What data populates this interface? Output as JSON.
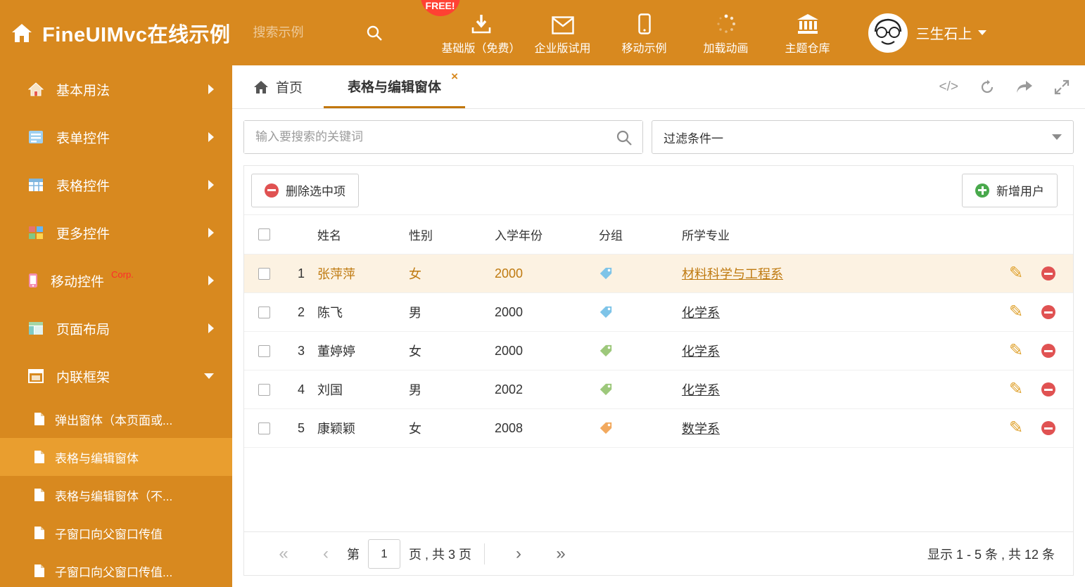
{
  "header": {
    "title": "FineUIMvc在线示例",
    "search_placeholder": "搜索示例",
    "free_badge": "FREE!",
    "nav": [
      {
        "label": "基础版（免费）"
      },
      {
        "label": "企业版试用"
      },
      {
        "label": "移动示例"
      },
      {
        "label": "加载动画"
      },
      {
        "label": "主题仓库"
      }
    ],
    "user_name": "三生石上"
  },
  "sidebar": {
    "items": [
      {
        "label": "基本用法"
      },
      {
        "label": "表单控件"
      },
      {
        "label": "表格控件"
      },
      {
        "label": "更多控件"
      },
      {
        "label": "移动控件",
        "badge": "Corp."
      },
      {
        "label": "页面布局"
      },
      {
        "label": "内联框架"
      }
    ],
    "subitems": [
      {
        "label": "弹出窗体（本页面或..."
      },
      {
        "label": "表格与编辑窗体"
      },
      {
        "label": "表格与编辑窗体（不..."
      },
      {
        "label": "子窗口向父窗口传值"
      },
      {
        "label": "子窗口向父窗口传值..."
      }
    ]
  },
  "tabs": {
    "home": "首页",
    "active": "表格与编辑窗体"
  },
  "filters": {
    "search_placeholder": "输入要搜索的关键词",
    "selected_filter": "过滤条件一"
  },
  "toolbar": {
    "delete_label": "删除选中项",
    "add_label": "新增用户"
  },
  "table": {
    "columns": {
      "name": "姓名",
      "gender": "性别",
      "year": "入学年份",
      "group": "分组",
      "major": "所学专业"
    },
    "rows": [
      {
        "num": "1",
        "name": "张萍萍",
        "gender": "女",
        "year": "2000",
        "tag_color": "#7EC4E8",
        "major": "材料科学与工程系"
      },
      {
        "num": "2",
        "name": "陈飞",
        "gender": "男",
        "year": "2000",
        "tag_color": "#7EC4E8",
        "major": "化学系"
      },
      {
        "num": "3",
        "name": "董婷婷",
        "gender": "女",
        "year": "2000",
        "tag_color": "#9DC87B",
        "major": "化学系"
      },
      {
        "num": "4",
        "name": "刘国",
        "gender": "男",
        "year": "2002",
        "tag_color": "#9DC87B",
        "major": "化学系"
      },
      {
        "num": "5",
        "name": "康颖颖",
        "gender": "女",
        "year": "2008",
        "tag_color": "#F2A95E",
        "major": "数学系"
      }
    ]
  },
  "pagination": {
    "page_label_prefix": "第",
    "page_value": "1",
    "page_label_suffix": "页 , 共 3 页",
    "summary": "显示 1 - 5 条 , 共 12 条"
  },
  "icons": {
    "edit": "✎",
    "first": "«",
    "prev": "‹",
    "next": "›",
    "last": "»",
    "code": "</>"
  }
}
